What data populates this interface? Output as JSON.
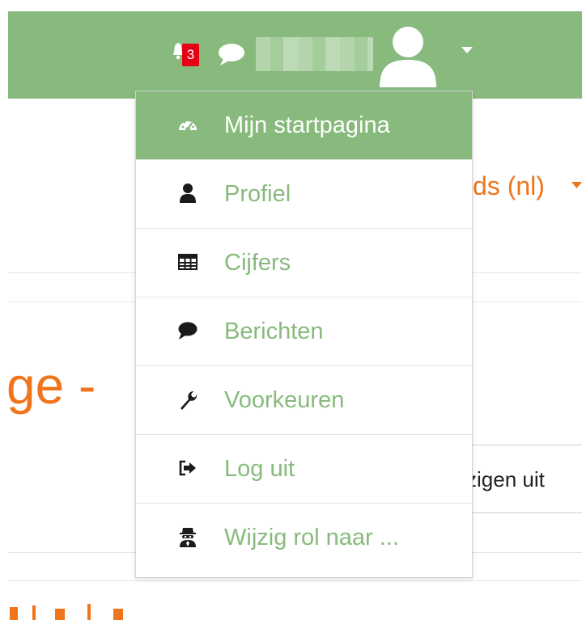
{
  "header": {
    "notification_count": "3",
    "username": "",
    "colors": {
      "bar": "#87ba7c",
      "badge": "#e50014",
      "accent": "#f0741b"
    }
  },
  "background": {
    "language_label": "ds (nl)",
    "title_fragment": "ge -",
    "button_fragment": "zigen uit"
  },
  "menu": {
    "items": [
      {
        "label": "Mijn startpagina",
        "icon": "dashboard-icon",
        "active": true
      },
      {
        "label": "Profiel",
        "icon": "user-icon"
      },
      {
        "label": "Cijfers",
        "icon": "table-icon"
      },
      {
        "label": "Berichten",
        "icon": "comment-icon"
      },
      {
        "label": "Voorkeuren",
        "icon": "wrench-icon"
      },
      {
        "label": "Log uit",
        "icon": "sign-out-icon"
      },
      {
        "label": "Wijzig rol naar ...",
        "icon": "user-secret-icon"
      }
    ]
  }
}
